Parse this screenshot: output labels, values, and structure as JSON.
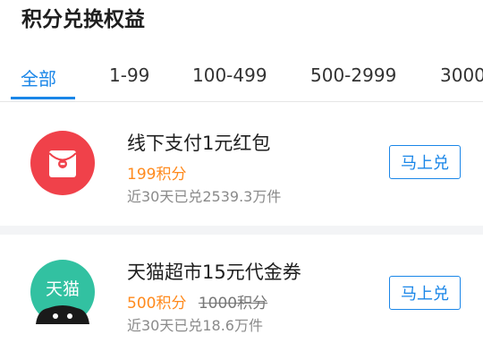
{
  "page": {
    "title": "积分兑换权益"
  },
  "tabs": [
    {
      "label": "全部",
      "active": true
    },
    {
      "label": "1-99"
    },
    {
      "label": "100-499"
    },
    {
      "label": "500-2999"
    },
    {
      "label": "3000"
    }
  ],
  "items": [
    {
      "title": "线下支付1元红包",
      "price": "199积分",
      "stat": "近30天已兑2539.3万件",
      "button": "马上兑",
      "icon": "red-envelope-icon"
    },
    {
      "title": "天猫超市15元代金券",
      "price": "500积分",
      "original_price": "1000积分",
      "stat": "近30天已兑18.6万件",
      "button": "马上兑",
      "icon": "tmall-logo-icon",
      "icon_text": "天猫"
    }
  ],
  "colors": {
    "accent": "#1a86e8",
    "price": "#ff8a1d",
    "red": "#f0414a",
    "tmall_green": "#32c1a1"
  }
}
